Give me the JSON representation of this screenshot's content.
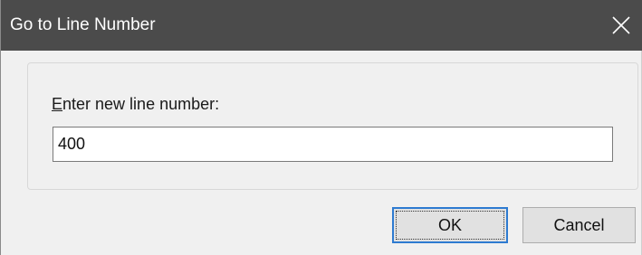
{
  "window": {
    "title": "Go to Line Number",
    "close_icon": "close-icon",
    "titlebar_color": "#4b4b4b"
  },
  "form": {
    "label_mnemonic": "E",
    "label_rest": "nter new line number:",
    "line_number_value": "400"
  },
  "buttons": {
    "ok_label": "OK",
    "cancel_label": "Cancel",
    "default_border_color": "#2e7bd1"
  }
}
